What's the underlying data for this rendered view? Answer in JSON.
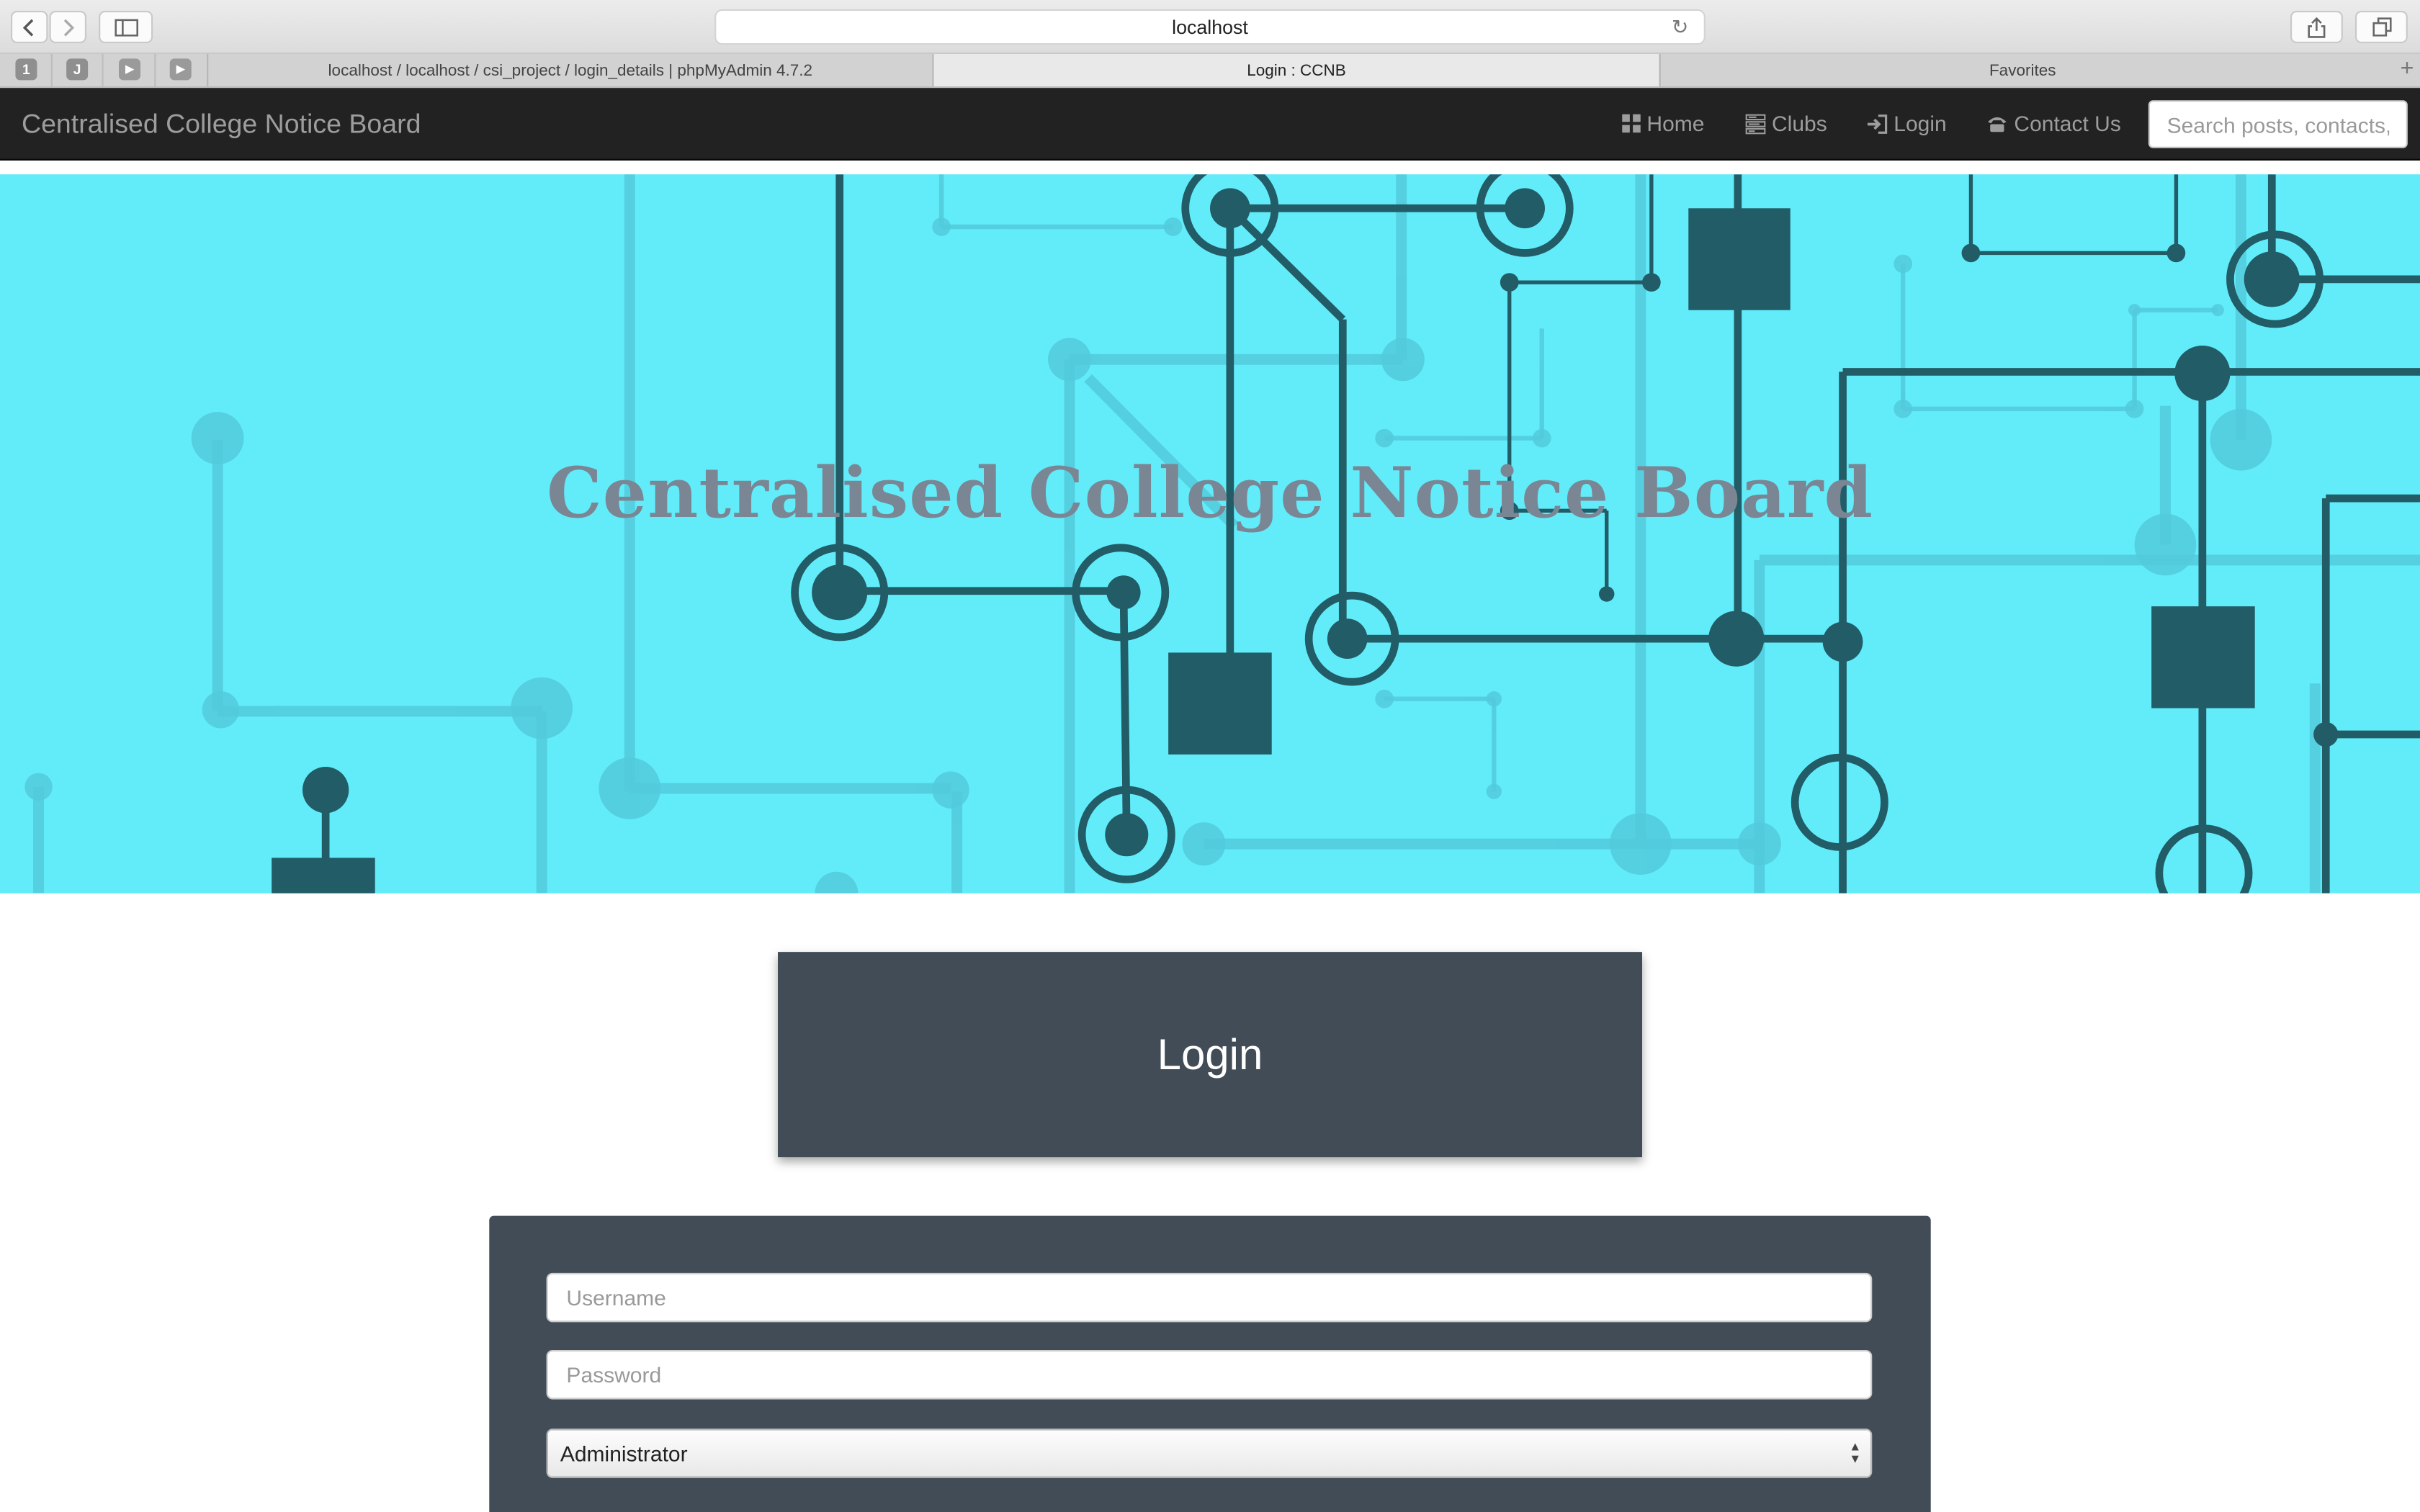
{
  "browser": {
    "url": "localhost",
    "pinned_tabs": [
      "1",
      "J"
    ],
    "tabs": [
      {
        "label": "localhost / localhost / csi_project / login_details | phpMyAdmin 4.7.2",
        "active": false
      },
      {
        "label": "Login : CCNB",
        "active": true
      },
      {
        "label": "Favorites",
        "active": false
      }
    ]
  },
  "navbar": {
    "brand": "Centralised College Notice Board",
    "items": [
      {
        "label": "Home",
        "icon": "th-large-icon"
      },
      {
        "label": "Clubs",
        "icon": "tasks-icon"
      },
      {
        "label": "Login",
        "icon": "log-in-icon"
      },
      {
        "label": "Contact Us",
        "icon": "phone-alt-icon"
      }
    ],
    "search_placeholder": "Search posts, contacts, clubs"
  },
  "hero": {
    "title": "Centralised College Notice Board",
    "background_color": "#62ecfa",
    "circuit_color": "#225c66"
  },
  "login": {
    "heading": "Login",
    "username_placeholder": "Username",
    "password_placeholder": "Password",
    "role_selected": "Administrator",
    "card_color": "#414c56"
  }
}
